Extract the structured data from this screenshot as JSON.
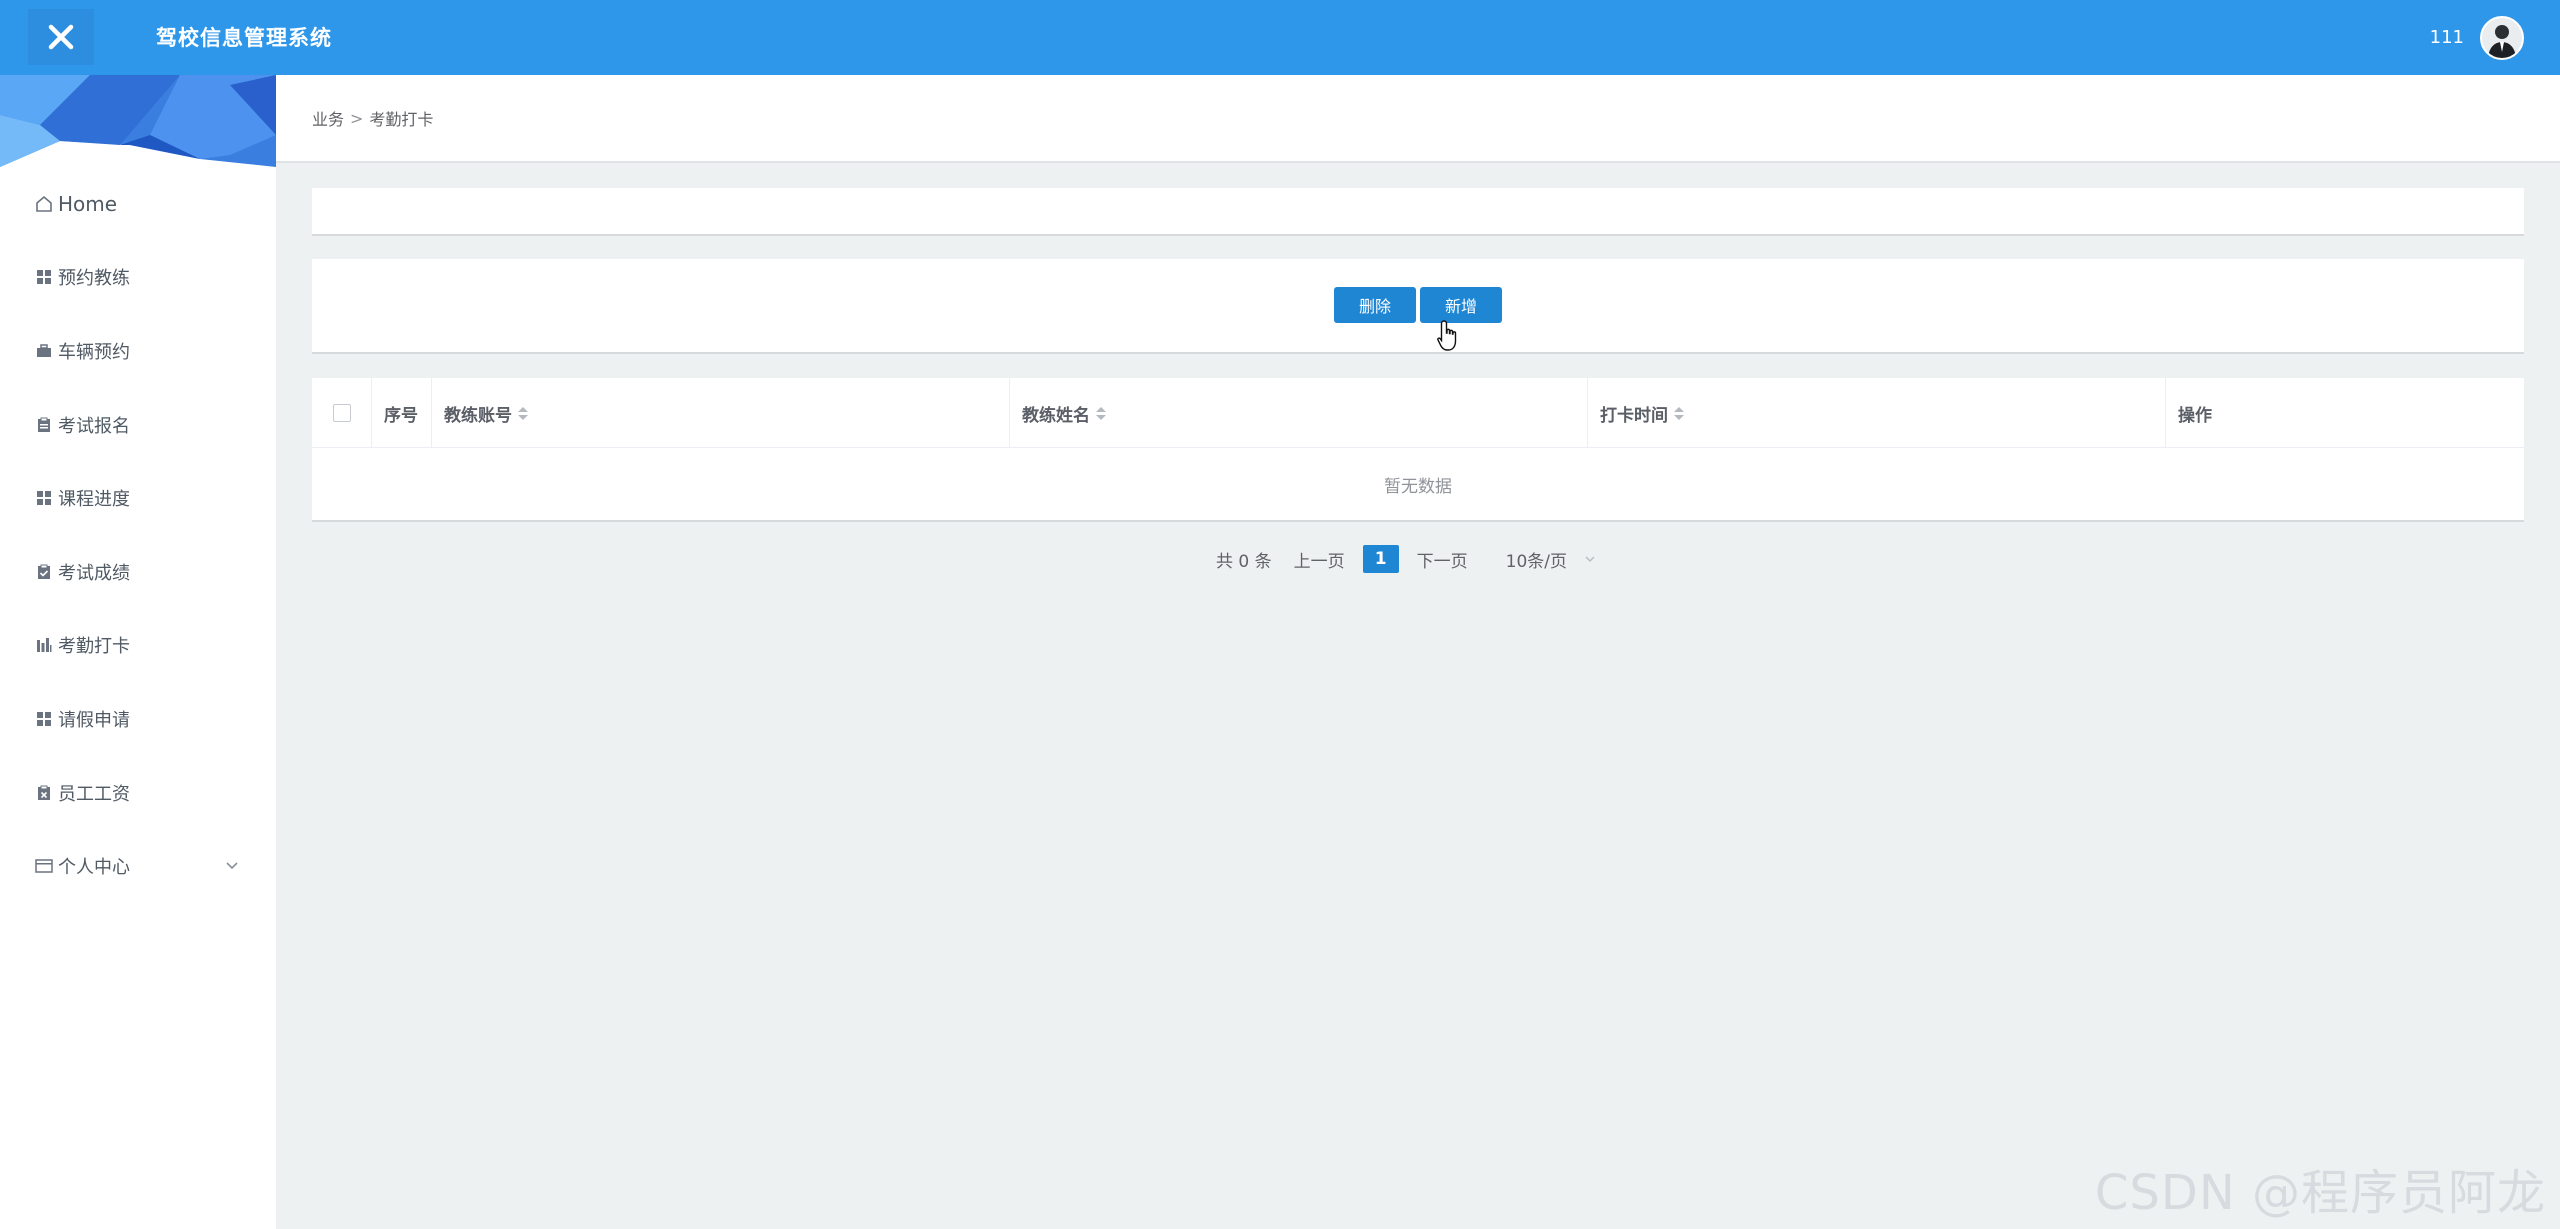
{
  "header": {
    "title": "驾校信息管理系统",
    "username": "111",
    "close_icon": "close-icon",
    "avatar_icon": "user-avatar"
  },
  "sidebar": {
    "items": [
      {
        "label": "Home",
        "icon": "home-icon"
      },
      {
        "label": "预约教练",
        "icon": "grid-icon"
      },
      {
        "label": "车辆预约",
        "icon": "briefcase-icon"
      },
      {
        "label": "考试报名",
        "icon": "clipboard-icon"
      },
      {
        "label": "课程进度",
        "icon": "grid-icon"
      },
      {
        "label": "考试成绩",
        "icon": "clipboard-check-icon"
      },
      {
        "label": "考勤打卡",
        "icon": "bar-chart-icon"
      },
      {
        "label": "请假申请",
        "icon": "grid-icon"
      },
      {
        "label": "员工工资",
        "icon": "clipboard-x-icon"
      },
      {
        "label": "个人中心",
        "icon": "card-icon",
        "expandable": true
      }
    ]
  },
  "breadcrumb": {
    "parent": "业务",
    "separator": ">",
    "current": "考勤打卡"
  },
  "actions": {
    "delete_label": "删除",
    "add_label": "新增"
  },
  "table": {
    "columns": [
      "序号",
      "教练账号",
      "教练姓名",
      "打卡时间",
      "操作"
    ],
    "empty_text": "暂无数据"
  },
  "pagination": {
    "total_text": "共 0 条",
    "prev_label": "上一页",
    "current_page": "1",
    "next_label": "下一页",
    "page_size_label": "10条/页"
  },
  "watermark": "CSDN @程序员阿龙",
  "colors": {
    "header_bg": "#2e97ea",
    "primary_button": "#1f86d4",
    "page_bg": "#eef1f1"
  }
}
